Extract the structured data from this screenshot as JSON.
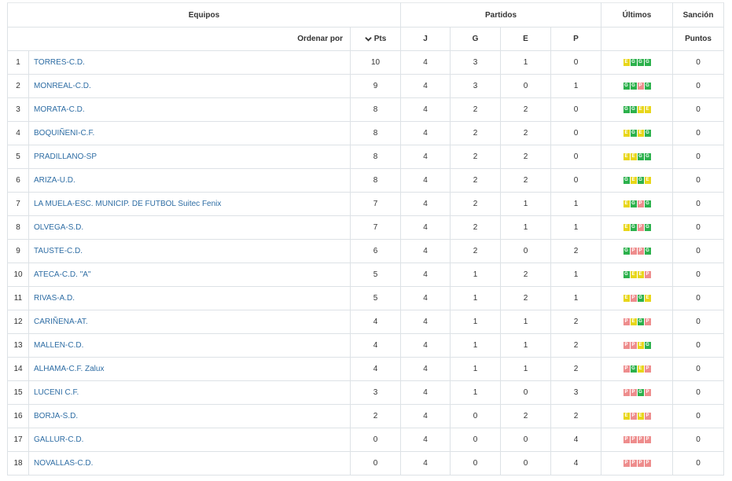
{
  "headers": {
    "equipos": "Equipos",
    "partidos": "Partidos",
    "ultimos": "Últimos",
    "sancion": "Sanción",
    "ordenar_por": "Ordenar por",
    "pts": "Pts",
    "j": "J",
    "g": "G",
    "e": "E",
    "p": "P",
    "puntos": "Puntos"
  },
  "colors": {
    "win": "#2cb14c",
    "draw": "#e8d61a",
    "loss": "#ee8d8d",
    "link": "#2e6da4"
  },
  "rows": [
    {
      "pos": "1",
      "team": "TORRES-C.D.",
      "pts": "10",
      "j": "4",
      "g": "3",
      "e": "1",
      "p": "0",
      "last": [
        "E",
        "G",
        "G",
        "G"
      ],
      "sancion": "0"
    },
    {
      "pos": "2",
      "team": "MONREAL-C.D.",
      "pts": "9",
      "j": "4",
      "g": "3",
      "e": "0",
      "p": "1",
      "last": [
        "G",
        "G",
        "P",
        "G"
      ],
      "sancion": "0"
    },
    {
      "pos": "3",
      "team": "MORATA-C.D.",
      "pts": "8",
      "j": "4",
      "g": "2",
      "e": "2",
      "p": "0",
      "last": [
        "G",
        "G",
        "E",
        "E"
      ],
      "sancion": "0"
    },
    {
      "pos": "4",
      "team": "BOQUIÑENI-C.F.",
      "pts": "8",
      "j": "4",
      "g": "2",
      "e": "2",
      "p": "0",
      "last": [
        "E",
        "G",
        "E",
        "G"
      ],
      "sancion": "0"
    },
    {
      "pos": "5",
      "team": "PRADILLANO-SP",
      "pts": "8",
      "j": "4",
      "g": "2",
      "e": "2",
      "p": "0",
      "last": [
        "E",
        "E",
        "G",
        "G"
      ],
      "sancion": "0"
    },
    {
      "pos": "6",
      "team": "ARIZA-U.D.",
      "pts": "8",
      "j": "4",
      "g": "2",
      "e": "2",
      "p": "0",
      "last": [
        "G",
        "E",
        "G",
        "E"
      ],
      "sancion": "0"
    },
    {
      "pos": "7",
      "team": "LA MUELA-ESC. MUNICIP. DE FUTBOL Suitec Fenix",
      "pts": "7",
      "j": "4",
      "g": "2",
      "e": "1",
      "p": "1",
      "last": [
        "E",
        "G",
        "P",
        "G"
      ],
      "sancion": "0"
    },
    {
      "pos": "8",
      "team": "OLVEGA-S.D.",
      "pts": "7",
      "j": "4",
      "g": "2",
      "e": "1",
      "p": "1",
      "last": [
        "E",
        "G",
        "P",
        "G"
      ],
      "sancion": "0"
    },
    {
      "pos": "9",
      "team": "TAUSTE-C.D.",
      "pts": "6",
      "j": "4",
      "g": "2",
      "e": "0",
      "p": "2",
      "last": [
        "G",
        "P",
        "P",
        "G"
      ],
      "sancion": "0"
    },
    {
      "pos": "10",
      "team": "ATECA-C.D. \"A\"",
      "pts": "5",
      "j": "4",
      "g": "1",
      "e": "2",
      "p": "1",
      "last": [
        "G",
        "E",
        "E",
        "P"
      ],
      "sancion": "0"
    },
    {
      "pos": "11",
      "team": "RIVAS-A.D.",
      "pts": "5",
      "j": "4",
      "g": "1",
      "e": "2",
      "p": "1",
      "last": [
        "E",
        "P",
        "G",
        "E"
      ],
      "sancion": "0"
    },
    {
      "pos": "12",
      "team": "CARIÑENA-AT.",
      "pts": "4",
      "j": "4",
      "g": "1",
      "e": "1",
      "p": "2",
      "last": [
        "P",
        "E",
        "G",
        "P"
      ],
      "sancion": "0"
    },
    {
      "pos": "13",
      "team": "MALLEN-C.D.",
      "pts": "4",
      "j": "4",
      "g": "1",
      "e": "1",
      "p": "2",
      "last": [
        "P",
        "P",
        "E",
        "G"
      ],
      "sancion": "0"
    },
    {
      "pos": "14",
      "team": "ALHAMA-C.F. Zalux",
      "pts": "4",
      "j": "4",
      "g": "1",
      "e": "1",
      "p": "2",
      "last": [
        "P",
        "G",
        "E",
        "P"
      ],
      "sancion": "0"
    },
    {
      "pos": "15",
      "team": "LUCENI C.F.",
      "pts": "3",
      "j": "4",
      "g": "1",
      "e": "0",
      "p": "3",
      "last": [
        "P",
        "P",
        "G",
        "P"
      ],
      "sancion": "0"
    },
    {
      "pos": "16",
      "team": "BORJA-S.D.",
      "pts": "2",
      "j": "4",
      "g": "0",
      "e": "2",
      "p": "2",
      "last": [
        "E",
        "P",
        "E",
        "P"
      ],
      "sancion": "0"
    },
    {
      "pos": "17",
      "team": "GALLUR-C.D.",
      "pts": "0",
      "j": "4",
      "g": "0",
      "e": "0",
      "p": "4",
      "last": [
        "P",
        "P",
        "P",
        "P"
      ],
      "sancion": "0"
    },
    {
      "pos": "18",
      "team": "NOVALLAS-C.D.",
      "pts": "0",
      "j": "4",
      "g": "0",
      "e": "0",
      "p": "4",
      "last": [
        "P",
        "P",
        "P",
        "P"
      ],
      "sancion": "0"
    }
  ]
}
